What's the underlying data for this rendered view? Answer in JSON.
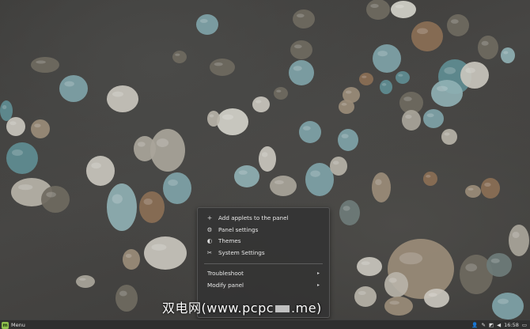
{
  "context_menu": {
    "items": [
      {
        "icon": "plus-icon",
        "label": "Add applets to the panel"
      },
      {
        "icon": "gear-icon",
        "label": "Panel settings"
      },
      {
        "icon": "palette-icon",
        "label": "Themes"
      },
      {
        "icon": "wrench-icon",
        "label": "System Settings"
      }
    ],
    "submenus": [
      {
        "label": "Troubleshoot"
      },
      {
        "label": "Modify panel"
      }
    ]
  },
  "panel": {
    "menu_label": "Menu",
    "clock": "16:58"
  },
  "watermark": {
    "text_before": "双电网(www.pcpc",
    "text_after": ".me)"
  },
  "colors": {
    "menu_bg": "#343434",
    "panel_bg": "#2f2f2f",
    "menu_logo": "#8fbf4d"
  }
}
